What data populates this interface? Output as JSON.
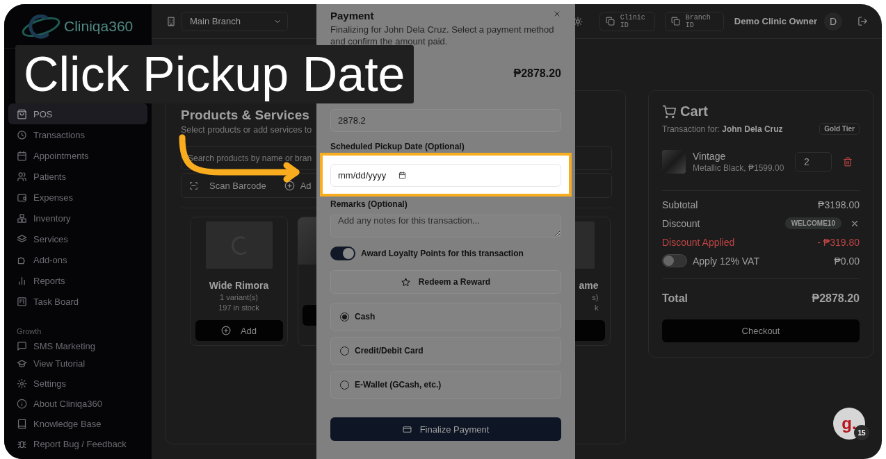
{
  "sidebar": {
    "logo": "Cliniqa360",
    "nav": [
      {
        "label": "POS",
        "selected": true
      },
      {
        "label": "Transactions",
        "selected": false
      },
      {
        "label": "Appointments",
        "selected": false
      },
      {
        "label": "Patients",
        "selected": false
      },
      {
        "label": "Expenses",
        "selected": false
      },
      {
        "label": "Inventory",
        "selected": false
      },
      {
        "label": "Services",
        "selected": false
      },
      {
        "label": "Add-ons",
        "selected": false
      },
      {
        "label": "Reports",
        "selected": false
      },
      {
        "label": "Task Board",
        "selected": false
      }
    ],
    "growth_heading": "Growth",
    "growth_items": [
      {
        "label": "SMS Marketing"
      }
    ],
    "footer": [
      {
        "label": "View Tutorial"
      },
      {
        "label": "Settings"
      },
      {
        "label": "About Cliniqa360"
      },
      {
        "label": "Knowledge Base"
      },
      {
        "label": "Report Bug / Feedback"
      }
    ]
  },
  "topbar": {
    "branch": "Main Branch",
    "clinic_id": "Clinic ID",
    "branch_id": "Branch ID",
    "user": "Demo Clinic Owner",
    "avatar": "D"
  },
  "products": {
    "title": "Products & Services",
    "subtitle": "Select products or add services to",
    "search_placeholder": "Search products by name or bran",
    "scan_button": "Scan Barcode",
    "add_service_button": "Ad",
    "cards": [
      {
        "kind": "placeholder",
        "name": "Wide Rimora",
        "variants": "1 variant(s)",
        "stock": "197 in stock",
        "button": "Add"
      },
      {
        "kind": "photo"
      },
      {
        "kind": "hidden"
      },
      {
        "kind": "placeholder",
        "name": "ame",
        "variants": "s)",
        "stock": "k"
      }
    ]
  },
  "cart": {
    "title": "Cart",
    "customer": "Transaction for: **John Dela Cruz**",
    "tier": "Gold Tier",
    "items": [
      {
        "name": "Vintage",
        "detail": "Metallic Black, ₱1599.00",
        "quantity": "2"
      }
    ],
    "subtotal_label": "Subtotal",
    "subtotal": "₱3198.00",
    "discount_label": "Discount",
    "discount_code": "WELCOME10",
    "discount_applied_label": "Discount Applied",
    "discount_applied": "- ₱319.80",
    "vat": {
      "label": "Apply 12% VAT",
      "on": false,
      "amount": "₱0.00"
    },
    "total_label": "Total",
    "total": "₱2878.20",
    "checkout": "Checkout"
  },
  "payment_modal": {
    "title": "Payment",
    "description": "Finalizing for John Dela Cruz. Select a payment method and confirm the amount paid.",
    "total_due": "₱2878.20",
    "amount_paid": "2878.2",
    "pickup_label": "Scheduled Pickup Date (Optional)",
    "pickup_placeholder": "mm/dd/yyyy",
    "remarks_label": "Remarks (Optional)",
    "remarks_placeholder": "Add any notes for this transaction...",
    "loyalty": {
      "label": "Award Loyalty Points for this transaction",
      "on": true
    },
    "redeem_button": "Redeem a Reward",
    "methods": [
      {
        "label": "Cash",
        "selected": true
      },
      {
        "label": "Credit/Debit Card",
        "selected": false
      },
      {
        "label": "E-Wallet (GCash, etc.)",
        "selected": false
      }
    ],
    "finalize_button": "Finalize Payment"
  },
  "tutorial": {
    "caption": "Click Pickup Date",
    "badge": "g.",
    "badge_count": "15"
  }
}
